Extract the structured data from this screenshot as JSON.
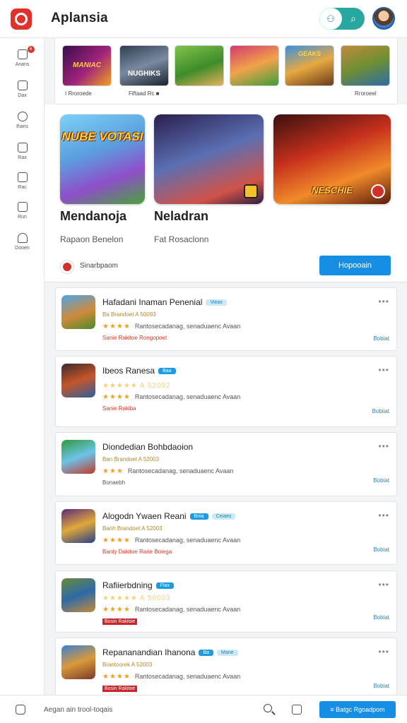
{
  "app": {
    "title": "Aplansia"
  },
  "colors": {
    "brand": "#e0312b",
    "accent": "#168ee3",
    "teal": "#27a7a0"
  },
  "header": {
    "search_icon": "search-icon",
    "filter_icon": "people-icon",
    "avatar": "user-avatar"
  },
  "sidebar": {
    "items": [
      {
        "label": "Anans",
        "icon": "home-icon",
        "badge": "6"
      },
      {
        "label": "Dax",
        "icon": "grid-icon"
      },
      {
        "label": "Ihans",
        "icon": "chat-icon"
      },
      {
        "label": "Rax",
        "icon": "mail-icon"
      },
      {
        "label": "Rac",
        "icon": "calendar-icon"
      },
      {
        "label": "Run",
        "icon": "cup-icon"
      },
      {
        "label": "Dooen",
        "icon": "bell-icon"
      }
    ]
  },
  "strip": {
    "items": [
      {
        "caption": "I  Rroroede",
        "art": "MANIAC"
      },
      {
        "caption": "Fiftaad  Rc  ■",
        "art": "NUGHIKS"
      },
      {
        "caption": "",
        "art": ""
      },
      {
        "caption": "",
        "art": ""
      },
      {
        "caption": "",
        "art": "GEAKS"
      },
      {
        "caption": "Rroroeel",
        "art": ""
      }
    ]
  },
  "featured": {
    "cards": [
      {
        "art": "NUBE VOTASI",
        "title": "Mendanoja",
        "subtitle": "Rapaon Benelon"
      },
      {
        "art": "",
        "title": "Neladran",
        "subtitle": "Fat Rosaclonn"
      },
      {
        "art": "NESCHIE",
        "title": "",
        "subtitle": ""
      }
    ],
    "developer": "Sinarbpaom",
    "button": "Hopooain"
  },
  "list": [
    {
      "title": "Hafadani Inaman Penenial",
      "tag": "Vieax",
      "tag_style": "light",
      "rating_line": "Ba Brandoet  A 50093",
      "desc": "Rantosecadanag, senaduaenc  Avaan",
      "stars": "★★★★",
      "footer": "Sanie Rakitoe   Rongopoet",
      "action": "Bobiat"
    },
    {
      "title": "Ibeos Ranesa",
      "tag": "Baa",
      "tag_style": "solid",
      "rating_line": "★★★★★  A 52092",
      "desc": "Rantosecadanag, senaduaenc  Avaan",
      "stars": "★★★★",
      "footer": "Sanie Rakiba",
      "action": "Bobiiat"
    },
    {
      "title": "Diondedian Bohbdaoion",
      "tag": "",
      "tag_style": "",
      "rating_line": "Ban Brandoet  A 52003",
      "desc": "Rantosecadanag, senaduaenc  Avaan",
      "stars": "★★★",
      "footer": "Bonaebh",
      "action": "Bobiat"
    },
    {
      "title": "Alogodn Ywaen Reani",
      "tag": "Bnia",
      "tag_style": "solid",
      "tag2": "Ceiaes",
      "rating_line": "Banh Brandoet  A 52003",
      "desc": "Rantosecadanag, senaduaenc  Avaan",
      "stars": "★★★★",
      "footer": "Banty Dakitoe   Rarie Boiega",
      "action": "Bobiat"
    },
    {
      "title": "Rafiierbdning",
      "tag": "Fiax",
      "tag_style": "solid",
      "rating_line": "★★★★★  A 50003",
      "desc": "Rantosecadanag, senaduaenc  Avaan",
      "stars": "★★★★",
      "footer": "Bosin   Rakitoe",
      "footer_style": "redtags",
      "action": "Bobiat"
    },
    {
      "title": "Repananandian Ihanona",
      "tag": "Ba",
      "tag_style": "solid",
      "tag2": "Mane",
      "rating_line": "Brantoorek  A 52003",
      "desc": "Rantosecadanag, senaduaenc  Avaan",
      "stars": "★★★★",
      "footer": "Bosin   Rakitoe",
      "footer_style": "redtags",
      "action": "Bobiat"
    }
  ],
  "bottom": {
    "text": "Aegan ain trool-toqais",
    "button": "≡  Batgc Rgoadpom"
  }
}
